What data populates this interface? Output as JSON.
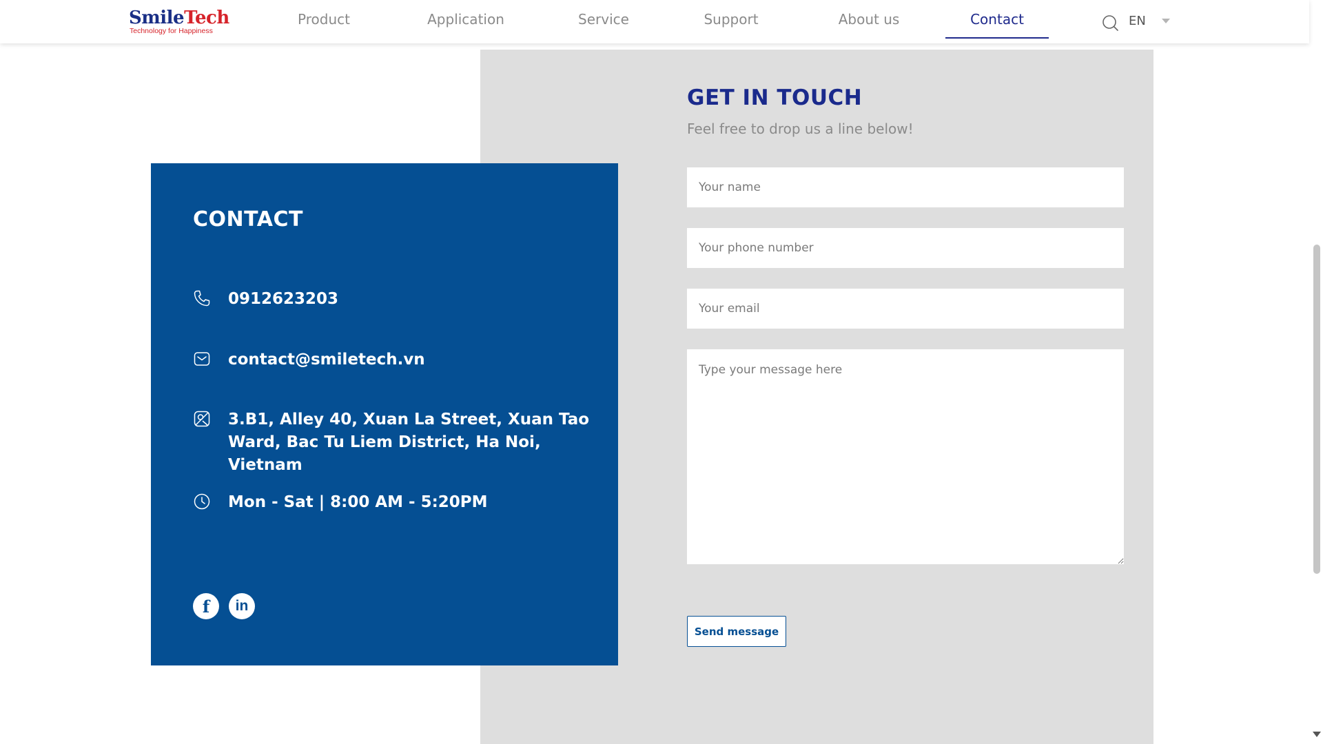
{
  "header": {
    "logo": {
      "brand_part1": "Smile",
      "brand_part2": "Tech",
      "tagline": "Technology for Happiness"
    },
    "nav": [
      {
        "label": "Product",
        "active": false
      },
      {
        "label": "Application",
        "active": false
      },
      {
        "label": "Service",
        "active": false
      },
      {
        "label": "Support",
        "active": false
      },
      {
        "label": "About us",
        "active": false
      },
      {
        "label": "Contact",
        "active": true
      }
    ],
    "language": "EN"
  },
  "contact": {
    "title": "CONTACT",
    "phone": "0912623203",
    "email": "contact@smiletech.vn",
    "address": "3.B1, Alley 40, Xuan La Street, Xuan Tao Ward, Bac Tu Liem District, Ha Noi, Vietnam",
    "hours": "Mon - Sat | 8:00 AM - 5:20PM",
    "socials": {
      "facebook_glyph": "f",
      "linkedin_glyph": "in"
    }
  },
  "form": {
    "title": "GET IN TOUCH",
    "subtitle": "Feel free to drop us a line below!",
    "name_placeholder": "Your name",
    "phone_placeholder": "Your phone number",
    "email_placeholder": "Your email",
    "message_placeholder": "Type your message here",
    "submit_label": "Send message"
  },
  "icons": {
    "search": "search-icon",
    "phone": "phone-icon",
    "email": "mail-icon",
    "address": "location-icon",
    "hours": "clock-icon"
  },
  "colors": {
    "primary_blue": "#054f93",
    "accent_navy": "#1a2a8c",
    "panel_gray": "#dedede",
    "logo_red": "#d6232a"
  }
}
